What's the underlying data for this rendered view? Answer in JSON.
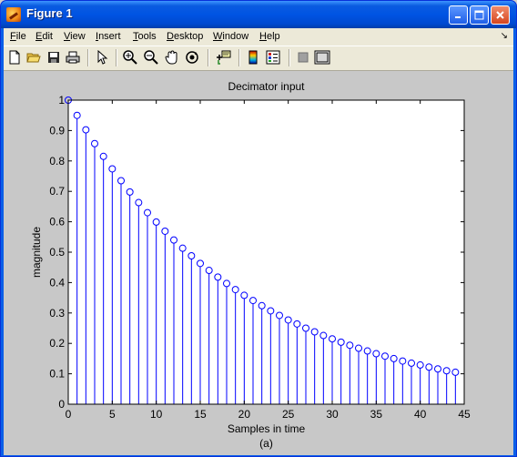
{
  "window": {
    "title": "Figure 1",
    "icon": "matlab-icon",
    "controls": [
      "minimize-icon",
      "maximize-icon",
      "close-icon"
    ]
  },
  "menubar": {
    "items": [
      {
        "label": "File",
        "ul": "F",
        "rest": "ile"
      },
      {
        "label": "Edit",
        "ul": "E",
        "rest": "dit"
      },
      {
        "label": "View",
        "ul": "V",
        "rest": "iew"
      },
      {
        "label": "Insert",
        "ul": "I",
        "rest": "nsert"
      },
      {
        "label": "Tools",
        "ul": "T",
        "rest": "ools"
      },
      {
        "label": "Desktop",
        "ul": "D",
        "rest": "esktop"
      },
      {
        "label": "Window",
        "ul": "W",
        "rest": "indow"
      },
      {
        "label": "Help",
        "ul": "H",
        "rest": "elp"
      }
    ]
  },
  "toolbar": {
    "icons": [
      "new-figure-icon",
      "open-file-icon",
      "save-icon",
      "print-icon",
      "select-arrow-icon",
      "zoom-in-icon",
      "zoom-out-icon",
      "pan-hand-icon",
      "rotate-3d-icon",
      "data-cursor-icon",
      "colorbar-icon",
      "legend-icon",
      "hide-plot-tools-icon",
      "show-plot-tools-icon"
    ]
  },
  "chart_data": {
    "type": "stem",
    "title": "Decimator input",
    "xlabel": "Samples in time",
    "ylabel": "magnitude",
    "caption": "(a)",
    "xlim": [
      0,
      45
    ],
    "ylim": [
      0,
      1
    ],
    "xticks": [
      0,
      5,
      10,
      15,
      20,
      25,
      30,
      35,
      40,
      45
    ],
    "yticks": [
      0,
      0.1,
      0.2,
      0.3,
      0.4,
      0.5,
      0.6,
      0.7,
      0.8,
      0.9,
      1
    ],
    "ytick_labels": [
      "0",
      "0.1",
      "0.2",
      "0.3",
      "0.4",
      "0.5",
      "0.6",
      "0.7",
      "0.8",
      "0.9",
      "1"
    ],
    "color": "#0000ff",
    "x": [
      0,
      1,
      2,
      3,
      4,
      5,
      6,
      7,
      8,
      9,
      10,
      11,
      12,
      13,
      14,
      15,
      16,
      17,
      18,
      19,
      20,
      21,
      22,
      23,
      24,
      25,
      26,
      27,
      28,
      29,
      30,
      31,
      32,
      33,
      34,
      35,
      36,
      37,
      38,
      39,
      40,
      41,
      42,
      43,
      44
    ],
    "y": [
      1.0,
      0.95,
      0.9025,
      0.857,
      0.815,
      0.774,
      0.735,
      0.698,
      0.663,
      0.63,
      0.599,
      0.569,
      0.54,
      0.513,
      0.488,
      0.463,
      0.44,
      0.418,
      0.397,
      0.377,
      0.358,
      0.341,
      0.324,
      0.307,
      0.292,
      0.277,
      0.264,
      0.25,
      0.238,
      0.226,
      0.215,
      0.204,
      0.194,
      0.184,
      0.175,
      0.166,
      0.158,
      0.15,
      0.142,
      0.135,
      0.129,
      0.122,
      0.116,
      0.11,
      0.105
    ]
  }
}
